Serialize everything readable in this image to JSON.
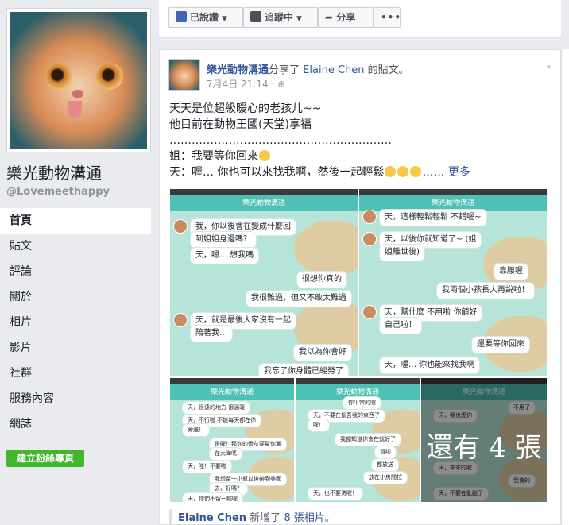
{
  "page": {
    "name": "樂光動物溝通",
    "handle": "@Lovemeethappy"
  },
  "nav": {
    "items": [
      {
        "label": "首頁",
        "active": true
      },
      {
        "label": "貼文"
      },
      {
        "label": "評論"
      },
      {
        "label": "關於"
      },
      {
        "label": "相片"
      },
      {
        "label": "影片"
      },
      {
        "label": "社群"
      },
      {
        "label": "服務內容"
      },
      {
        "label": "網誌"
      }
    ],
    "create_label": "建立粉絲專頁"
  },
  "actionbar": {
    "like_label": "已說讚",
    "follow_label": "追蹤中",
    "share_label": "分享",
    "more_label": "•••"
  },
  "post": {
    "author": "樂光動物溝通",
    "shared_text": "分享了",
    "original_author": "Elaine Chen",
    "post_suffix": "的貼文。",
    "timestamp": "7月4日 21:14",
    "text_lines": [
      "天天是位超級暖心的老孩儿~~",
      "他目前在動物王國(天堂)享福",
      "……………………………………………………",
      "姐：我要等你回來",
      "天：喔… 你也可以來找我啊，然後一起輕鬆"
    ],
    "ellipsis": "……",
    "see_more": "更多",
    "photos_more": "還有 4 張",
    "footer_author": "Elaine Chen",
    "footer_text": "新增了",
    "footer_photos": "8 張相片。",
    "footer_end": "",
    "screenshots": {
      "title": "樂光動物溝通",
      "s1": [
        "我，你以後會在變成什麼回",
        "到姐姐身邊嗎？",
        "天，嗯… 想我嗎",
        "很想你真的",
        "我很難過，但又不敢太難過",
        "天，就是最後大家沒有一起",
        "陪著我…",
        "我以為你會好",
        "我忘了你身體已經勞了"
      ],
      "s2": [
        "天，這樣輕鬆輕鬆 不錯喔~",
        "天，以後你就知道了~ (姐",
        "姐離世後)",
        "靠腰喔",
        "我兩個小孩長大再說啦！",
        "天，幫什麼 不用啦 你顧好",
        "自己啦！",
        "還要等你回來",
        "天，喔… 你也能來找我啊"
      ],
      "s3": [
        "天，很遠的地方 很溫暖",
        "天，不行啦 不能每天都在你",
        "旁邊！",
        "是喔！那你的骨灰要幫你灑",
        "在大海嗎",
        "天，陸！不要啦",
        "我想留一小瓶以後帶到美國",
        "去，好嗎？",
        "天，你們不留一點喔"
      ],
      "s4": [
        "你平常的喔",
        "天，不要在偷吾我的東西了",
        "喔！",
        "我都知道你會在就好了",
        "買啦",
        "都放送",
        "放在小房間拉",
        "天，也不要洗喔！"
      ],
      "s5": [
        "天，我也愛你",
        "不用了",
        "天，乖乖的喔",
        "我會的",
        "天，不要在亂跑了"
      ]
    }
  }
}
